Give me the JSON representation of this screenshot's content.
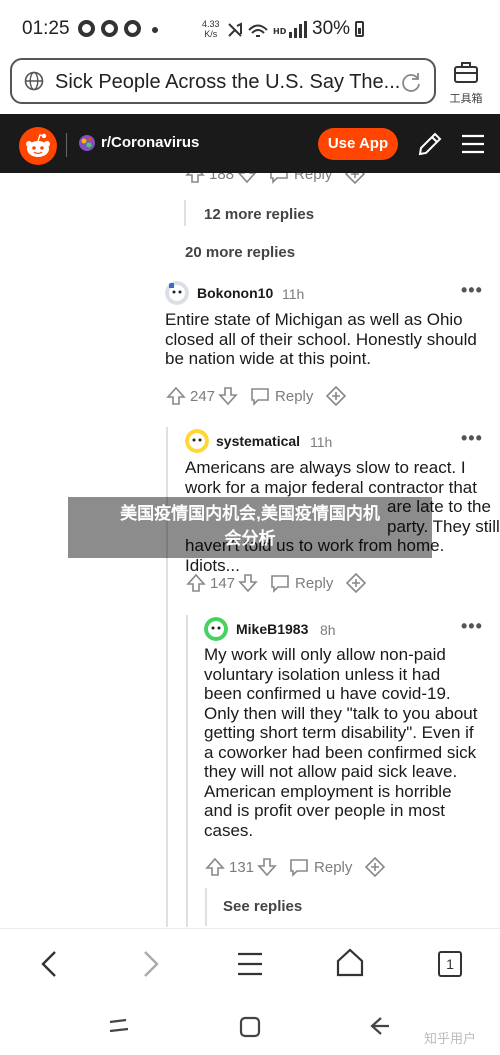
{
  "status_bar": {
    "time": "01:25",
    "speed_value": "4.33",
    "speed_unit": "K/s",
    "battery": "30%"
  },
  "browser": {
    "page_title": "Sick People Across the U.S. Say The...",
    "toolbox_label": "工具箱",
    "tab_count": "1"
  },
  "reddit": {
    "subreddit": "r/Coronavirus",
    "use_app_label": "Use App",
    "brand_color": "#ff4500"
  },
  "thread": {
    "partial_votes": "188",
    "partial_reply": "Reply",
    "more_replies_12": "12 more replies",
    "more_replies_20": "20 more replies",
    "comments": [
      {
        "user": "Bokonon10",
        "age": "11h",
        "body_lines": [
          "Entire state of Michigan as well as Ohio",
          "closed all of their school. Honestly should",
          "be nation wide at this point."
        ],
        "votes": "247",
        "reply_label": "Reply"
      },
      {
        "user": "systematical",
        "age": "11h",
        "body_lines": [
          "Americans are always slow to react. I",
          "work for a major federal contractor that",
          "are late to the party. They still",
          "haven't told us to work from home.",
          "Idiots..."
        ],
        "votes": "147",
        "reply_label": "Reply"
      },
      {
        "user": "MikeB1983",
        "age": "8h",
        "body_lines": [
          "My work will only allow non-paid",
          "voluntary isolation unless it had",
          "been confirmed u have covid-19.",
          "Only then will they \"talk to you about",
          "getting short term disability\". Even if",
          "a coworker had been confirmed sick",
          "they will not allow paid sick leave.",
          "American employment is horrible",
          "and is profit over people in most",
          "cases."
        ],
        "votes": "131",
        "reply_label": "Reply"
      }
    ],
    "see_replies": "See replies"
  },
  "overlay": {
    "line1": "美国疫情国内机会,美国疫情国内机",
    "line2": "会分析"
  },
  "watermark": "知乎用户"
}
